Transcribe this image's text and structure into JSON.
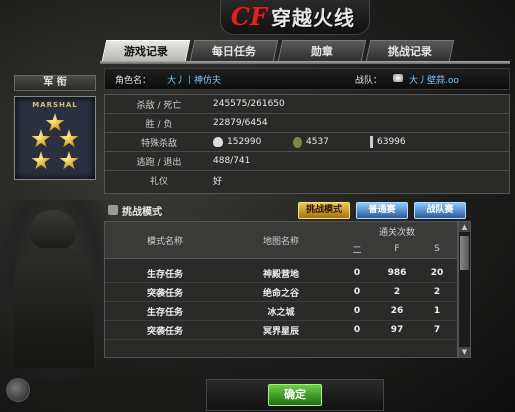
{
  "logo": {
    "cf": "CF",
    "text": "穿越火线"
  },
  "tabs": [
    {
      "label": "游戏记录",
      "active": true
    },
    {
      "label": "每日任务",
      "active": false
    },
    {
      "label": "勋章",
      "active": false
    },
    {
      "label": "挑战记录",
      "active": false
    }
  ],
  "rank": {
    "header": "军 衔",
    "badge_label": "MARSHAL"
  },
  "player": {
    "name_label": "角色名：",
    "name_value": "大丿丨神仿夫",
    "team_label": "战队：",
    "team_value": "大丿壁蒜.oo"
  },
  "stats": [
    {
      "label": "杀敌 / 死亡",
      "value": "245575/261650"
    },
    {
      "label": "胜 / 负",
      "value": "22879/6454"
    },
    {
      "label": "特殊杀敌",
      "value_headshot": "152990",
      "value_grenade": "4537",
      "value_knife": "63996"
    },
    {
      "label": "逃跑 / 退出",
      "value": "488/741"
    },
    {
      "label": "礼仪",
      "value": "好"
    }
  ],
  "challenge": {
    "title": "挑战模式",
    "buttons": {
      "mode": "挑战模式",
      "normal": "普通赛",
      "team": "战队赛"
    }
  },
  "table": {
    "col_mode": "模式名称",
    "col_map": "地图名称",
    "col_clear": "通关次数",
    "col_easy": "二",
    "col_normal": "F",
    "col_hard": "S",
    "rows": [
      {
        "mode": "生存任务",
        "map": "神殿营地",
        "easy": "0",
        "normal": "986",
        "hard": "20"
      },
      {
        "mode": "突袭任务",
        "map": "绝命之谷",
        "easy": "0",
        "normal": "2",
        "hard": "2"
      },
      {
        "mode": "生存任务",
        "map": "冰之城",
        "easy": "0",
        "normal": "26",
        "hard": "1"
      },
      {
        "mode": "突袭任务",
        "map": "冥界星辰",
        "easy": "0",
        "normal": "97",
        "hard": "7"
      }
    ]
  },
  "confirm_label": "确定"
}
